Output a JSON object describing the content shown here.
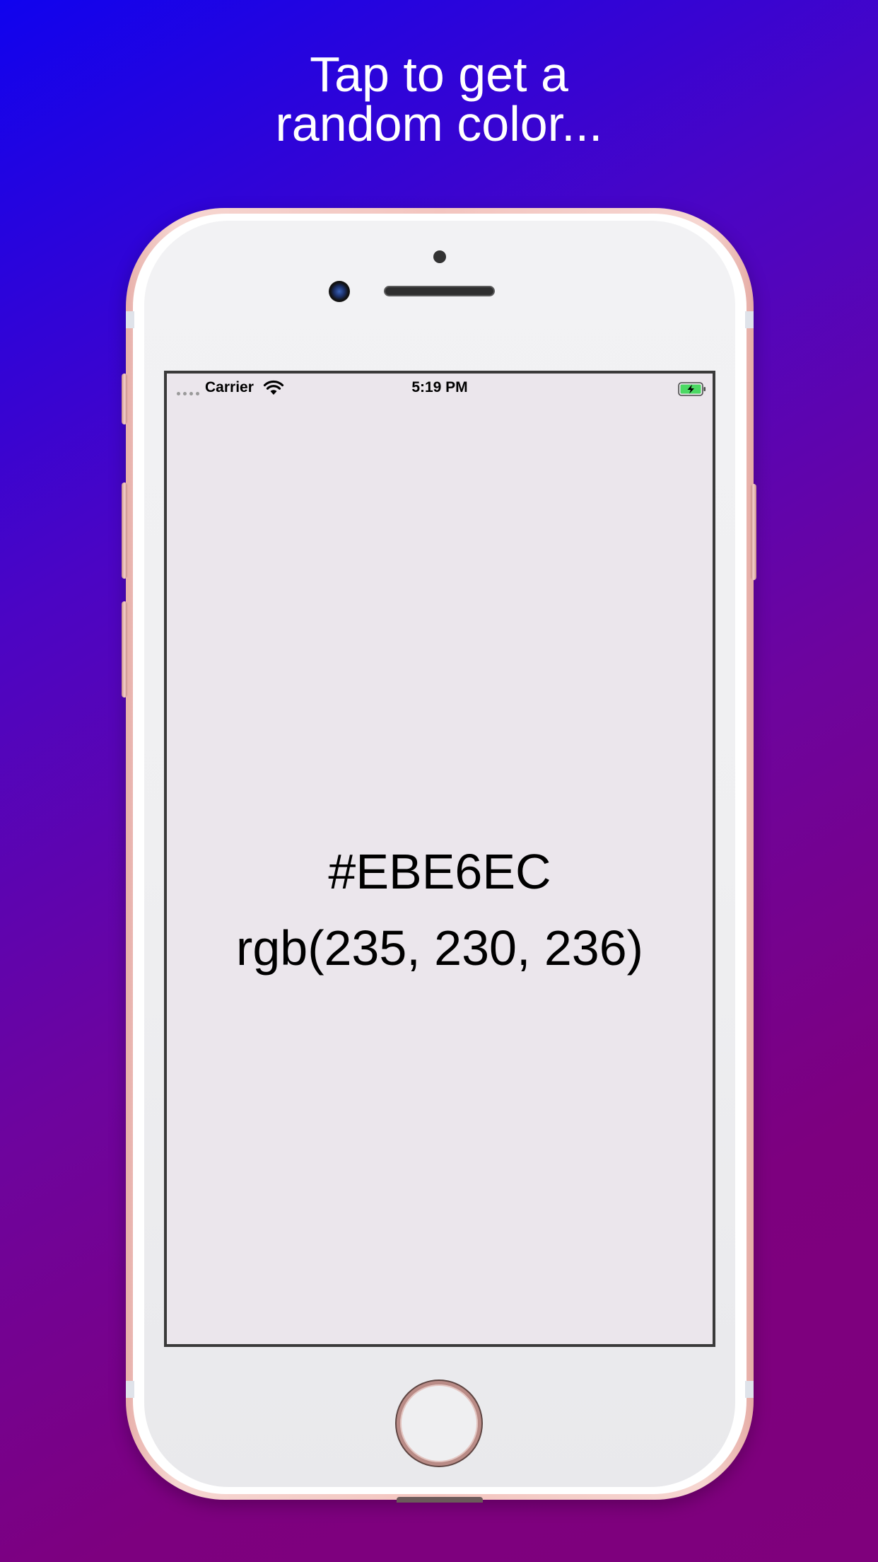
{
  "headline": {
    "line1": "Tap to get a",
    "line2": "random color..."
  },
  "status_bar": {
    "carrier": "Carrier",
    "time": "5:19 PM",
    "wifi_icon": "wifi-icon",
    "battery_icon": "battery-charging-icon",
    "signal_icon": "signal-dots-icon"
  },
  "color_display": {
    "hex": "#EBE6EC",
    "rgb": "rgb(235, 230, 236)"
  },
  "colors": {
    "background_start": "#1003ee",
    "background_end": "#7f007c",
    "screen_color": "#EBE6EC",
    "phone_frame": "#f3c5bf"
  }
}
